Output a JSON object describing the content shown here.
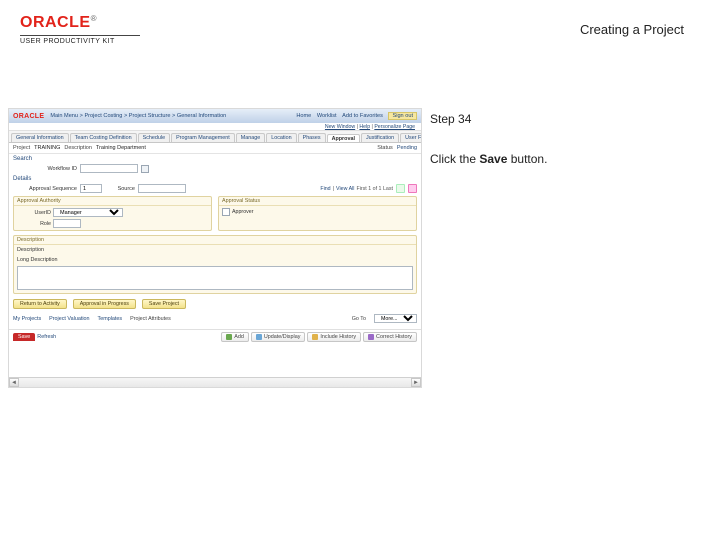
{
  "header": {
    "logo_text": "ORACLE",
    "logo_reg": "®",
    "sub": "USER PRODUCTIVITY KIT",
    "title": "Creating a Project"
  },
  "instruction": {
    "step_label": "Step 34",
    "before": "Click the ",
    "bold": "Save",
    "after": " button."
  },
  "screenshot": {
    "topbar": {
      "logo": "ORACLE",
      "crumbs": [
        "Main Menu",
        ">",
        "Project Costing",
        ">",
        "Project Structure",
        ">",
        "General Information"
      ],
      "right": {
        "user": "Home",
        "worklist": "Worklist",
        "add_fav": "Add to Favorites",
        "signout": "Sign out"
      }
    },
    "subbar": {
      "new_window": "New Window",
      "help": "Help",
      "personalize": "Personalize Page"
    },
    "tabs": [
      "General Information",
      "Team Costing Definition",
      "Schedule",
      "Program Management",
      "Manage",
      "Location",
      "Phases",
      "Approval",
      "Justification",
      "User Fields"
    ],
    "active_tab_index": 7,
    "tabs_more_label": "▸",
    "band1": {
      "label1": "Project",
      "val1": "TRAINING",
      "label2": "Description",
      "val2": "Training Department",
      "label3": "Status",
      "val3": "Pending"
    },
    "section1": "Search",
    "row_workflow": {
      "label": "Workflow ID",
      "value": ""
    },
    "section2": "Details",
    "row_details": {
      "seq_label": "Approval Sequence",
      "seq_value": "1",
      "src_label": "Source",
      "src_value": ""
    },
    "pager": {
      "find": "Find",
      "viewall": "View All",
      "range": "First 1 of 1 Last"
    },
    "panel_left": {
      "title": "Approval Authority",
      "row1": {
        "label": "UserID",
        "value": "Manager"
      },
      "row2": {
        "label": "Role",
        "value": ""
      }
    },
    "panel_right": {
      "title": "Approval Status",
      "row1": {
        "label": "",
        "check_label": "Approver"
      }
    },
    "desc_panel": {
      "title": "Description",
      "row1": "Description",
      "row2": "Long Description"
    },
    "yellow_buttons": [
      "Return to Activity",
      "Approval in Progress",
      "Save Project"
    ],
    "footlinks": {
      "my_projects": "My Projects",
      "valuation": "Project Valuation",
      "templates": "Templates",
      "attrib_label": "Project Attributes",
      "goto_label": "Go To",
      "goto_value": "More..."
    },
    "toolbar": {
      "tab": "Save",
      "refresh": "Refresh",
      "add": "Add",
      "display": "Update/Display",
      "history": "Include History",
      "correct": "Correct History"
    }
  }
}
